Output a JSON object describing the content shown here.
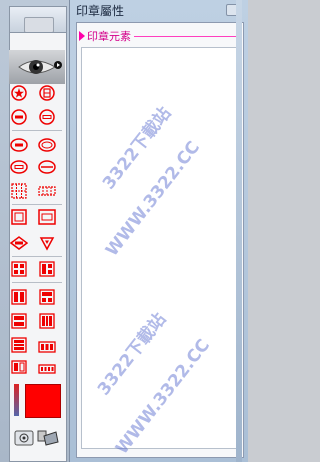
{
  "panel": {
    "title": "印章屬性",
    "section_label": "印章元素"
  },
  "watermark": {
    "line1": "3322下載站",
    "line2": "WWW.3322.CC"
  },
  "colors": {
    "accent_red": "#ff0000",
    "section_pink": "#d4008a"
  },
  "tools": [
    "star-circle-icon",
    "stamp-circle-icon",
    "circle-icon",
    "rounded-rect-icon",
    "ellipse-double-icon",
    "ellipse-icon",
    "ellipse-thin-icon",
    "ellipse-wide-icon",
    "grid-square-icon",
    "grid-rect-icon",
    "square-frame-icon",
    "rect-frame-icon",
    "diamond-icon",
    "triangle-icon",
    "grid-2x2-icon",
    "grid-split-icon",
    "layout-a-icon",
    "layout-b-icon",
    "layout-c-icon",
    "layout-d-icon",
    "layout-e-icon",
    "layout-f-icon",
    "layout-g-icon",
    "layout-h-icon"
  ]
}
